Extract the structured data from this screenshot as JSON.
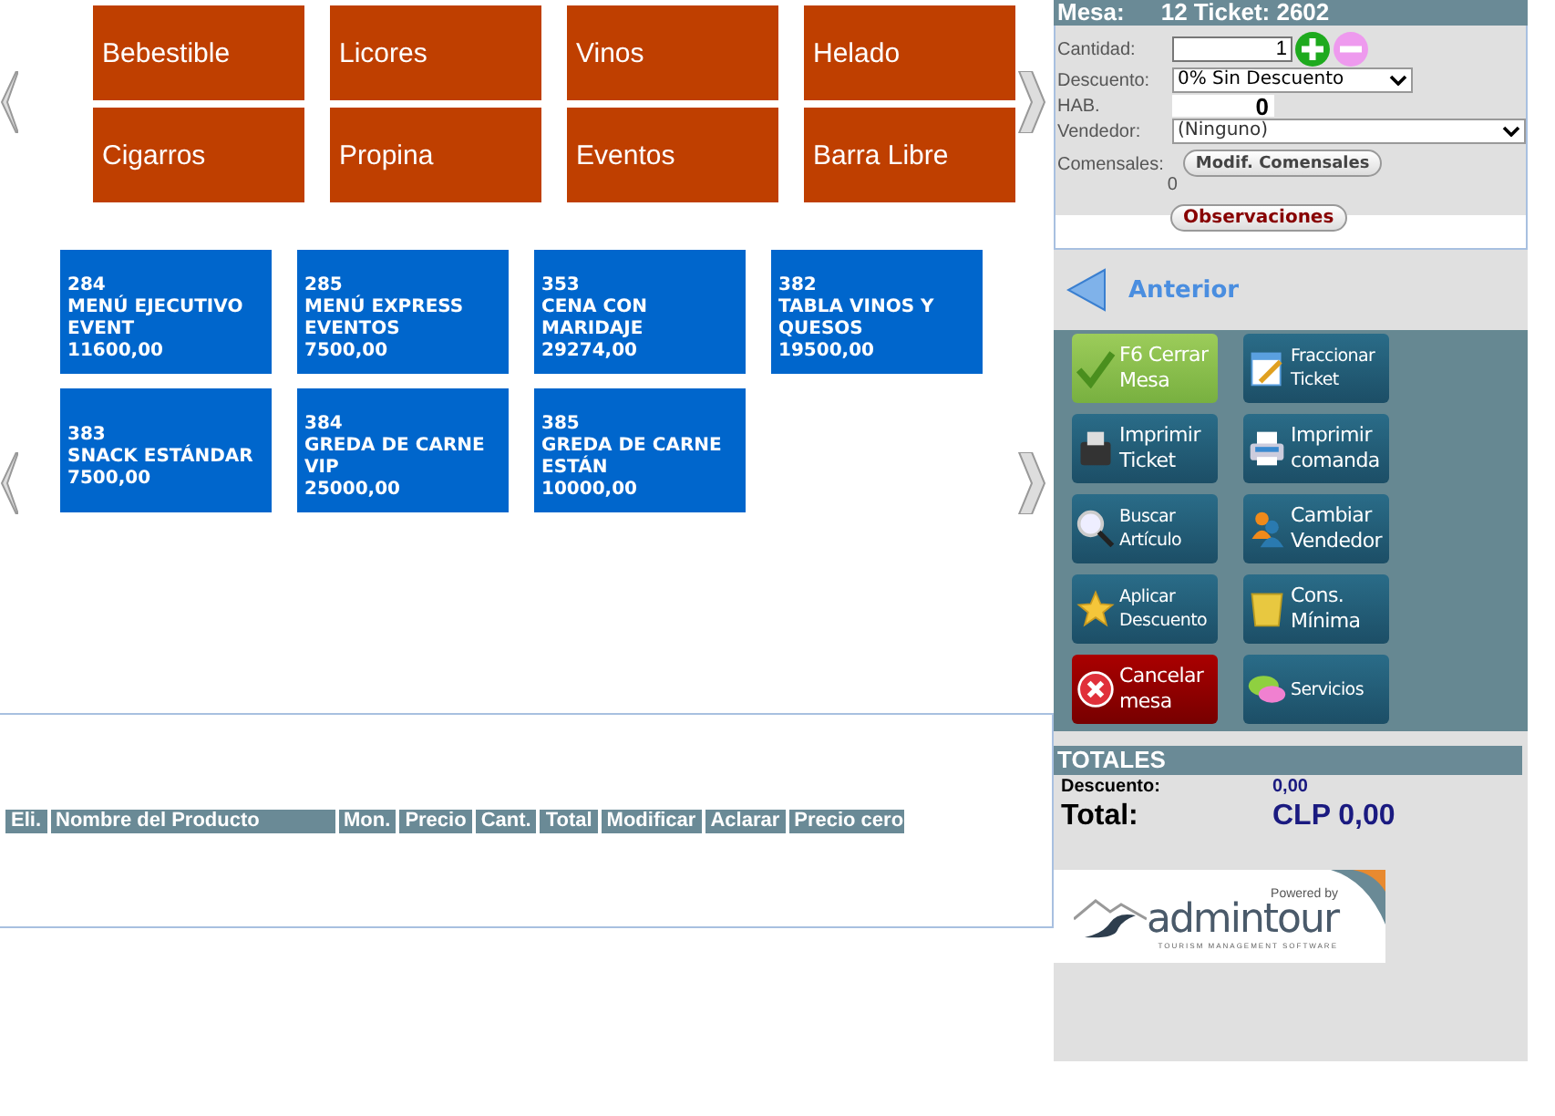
{
  "categories": [
    "Bebestible",
    "Licores",
    "Vinos",
    "Helado",
    "Cigarros",
    "Propina",
    "Eventos",
    "Barra Libre"
  ],
  "products": [
    {
      "code": "284",
      "name": [
        "MENÚ EJECUTIVO",
        "EVENT"
      ],
      "price": "11600,00"
    },
    {
      "code": "285",
      "name": [
        "MENÚ EXPRESS",
        "EVENTOS"
      ],
      "price": "7500,00"
    },
    {
      "code": "353",
      "name": [
        "CENA CON",
        "MARIDAJE"
      ],
      "price": "29274,00"
    },
    {
      "code": "382",
      "name": [
        "TABLA VINOS Y",
        "QUESOS"
      ],
      "price": "19500,00"
    },
    {
      "code": "383",
      "name": [
        "SNACK ESTÁNDAR"
      ],
      "price": "7500,00"
    },
    {
      "code": "384",
      "name": [
        "GREDA DE CARNE",
        "VIP"
      ],
      "price": "25000,00"
    },
    {
      "code": "385",
      "name": [
        "GREDA DE CARNE",
        "ESTÁN"
      ],
      "price": "10000,00"
    }
  ],
  "table": {
    "columns": [
      "Eli.",
      "Nombre del Producto",
      "Mon.",
      "Precio",
      "Cant.",
      "Total",
      "Modificar",
      "Aclarar",
      "Precio cero"
    ]
  },
  "order": {
    "mesa_label": "Mesa:",
    "mesa_value": "12 Ticket: 2602",
    "cantidad": {
      "label": "Cantidad:",
      "value": "1"
    },
    "descuento": {
      "label": "Descuento:",
      "value": "0% Sin Descuento"
    },
    "hab": {
      "label": "HAB.",
      "value": "0"
    },
    "vendedor": {
      "label": "Vendedor:",
      "value": "(Ninguno)"
    },
    "comensales": {
      "label": "Comensales:",
      "value": "0",
      "button": "Modif. Comensales"
    },
    "observaciones": "Observaciones"
  },
  "back": "Anterior",
  "actions": [
    {
      "lines": [
        "F6 Cerrar",
        "Mesa"
      ],
      "kind": "confirm"
    },
    {
      "lines": [
        "Fraccionar",
        "Ticket"
      ],
      "kind": "normal"
    },
    {
      "lines": [
        "Imprimir",
        "Ticket"
      ],
      "kind": "normal"
    },
    {
      "lines": [
        "Imprimir",
        "comanda"
      ],
      "kind": "normal"
    },
    {
      "lines": [
        "Buscar",
        "Artículo"
      ],
      "kind": "normal"
    },
    {
      "lines": [
        "Cambiar",
        "Vendedor"
      ],
      "kind": "normal"
    },
    {
      "lines": [
        "Aplicar",
        "Descuento"
      ],
      "kind": "normal"
    },
    {
      "lines": [
        "Cons.",
        "Mínima"
      ],
      "kind": "normal"
    },
    {
      "lines": [
        "Cancelar",
        "mesa"
      ],
      "kind": "cancel"
    },
    {
      "lines": [
        "Servicios"
      ],
      "kind": "normal"
    }
  ],
  "totals": {
    "title": "TOTALES",
    "discount_label": "Descuento:",
    "discount_value": "0,00",
    "total_label": "Total:",
    "total_value": "CLP 0,00"
  },
  "logo": {
    "powered": "Powered by",
    "brand": "admintour",
    "tagline": "TOURISM MANAGEMENT SOFTWARE"
  }
}
